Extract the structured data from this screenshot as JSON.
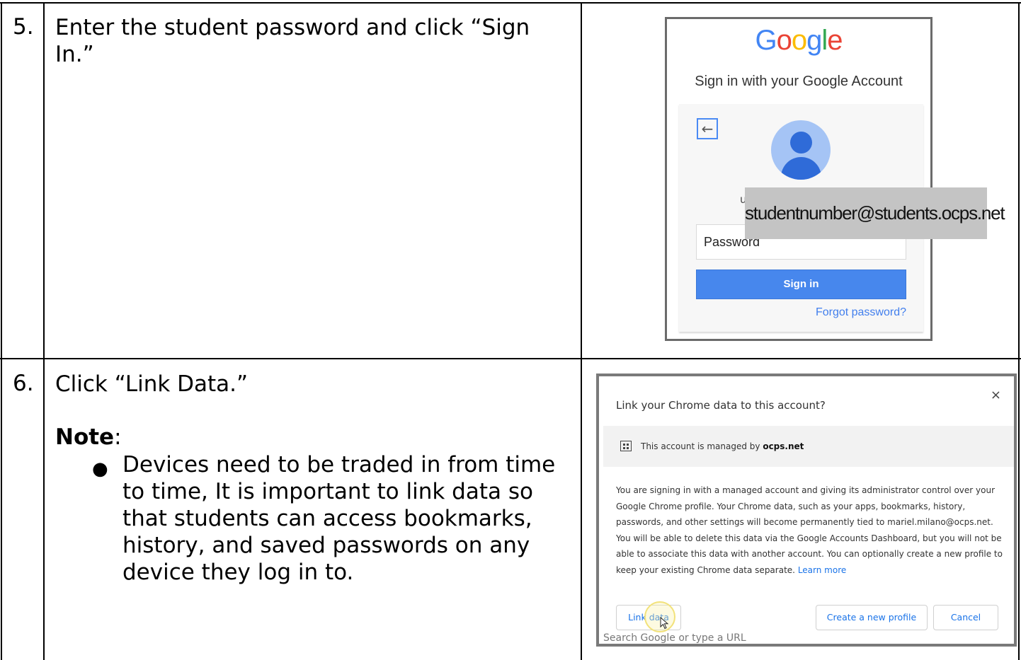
{
  "rows": [
    {
      "number": "5.",
      "instruction": "Enter the student password and click “Sign In.”"
    },
    {
      "number": "6.",
      "instruction": "Click “Link Data.”",
      "note_label": "Note",
      "note_colon": ":",
      "bullet": "Devices need to be traded in from time to time, It is important to link data so that students can access bookmarks, history, and saved passwords on any device they log in to."
    }
  ],
  "google_signin": {
    "logo_letters": [
      "G",
      "o",
      "o",
      "g",
      "l",
      "e"
    ],
    "logo_colors": [
      "#4285f4",
      "#ea4335",
      "#fbbc05",
      "#4285f4",
      "#34a853",
      "#ea4335"
    ],
    "title": "Sign in with your Google Account",
    "email_fragment": "u",
    "password_placeholder": "Password",
    "sign_in_label": "Sign in",
    "forgot_label": "Forgot password?",
    "email_overlay": "studentnumber@students.ocps.net"
  },
  "link_dialog": {
    "title": "Link your Chrome data to this account?",
    "close_symbol": "×",
    "managed_prefix": "This account is managed by ",
    "managed_domain": "ocps.net",
    "body": "You are signing in with a managed account and giving its administrator control over your Google Chrome profile. Your Chrome data, such as your apps, bookmarks, history, passwords, and other settings will become permanently tied to mariel.milano@ocps.net. You will be able to delete this data via the Google Accounts Dashboard, but you will not be able to associate this data with another account. You can optionally create a new profile to keep your existing Chrome data separate.",
    "learn_more": "Learn more",
    "link_data_label": "Link data",
    "create_profile_label": "Create a new profile",
    "cancel_label": "Cancel",
    "ghost_text": "Search Google or type a URL"
  }
}
